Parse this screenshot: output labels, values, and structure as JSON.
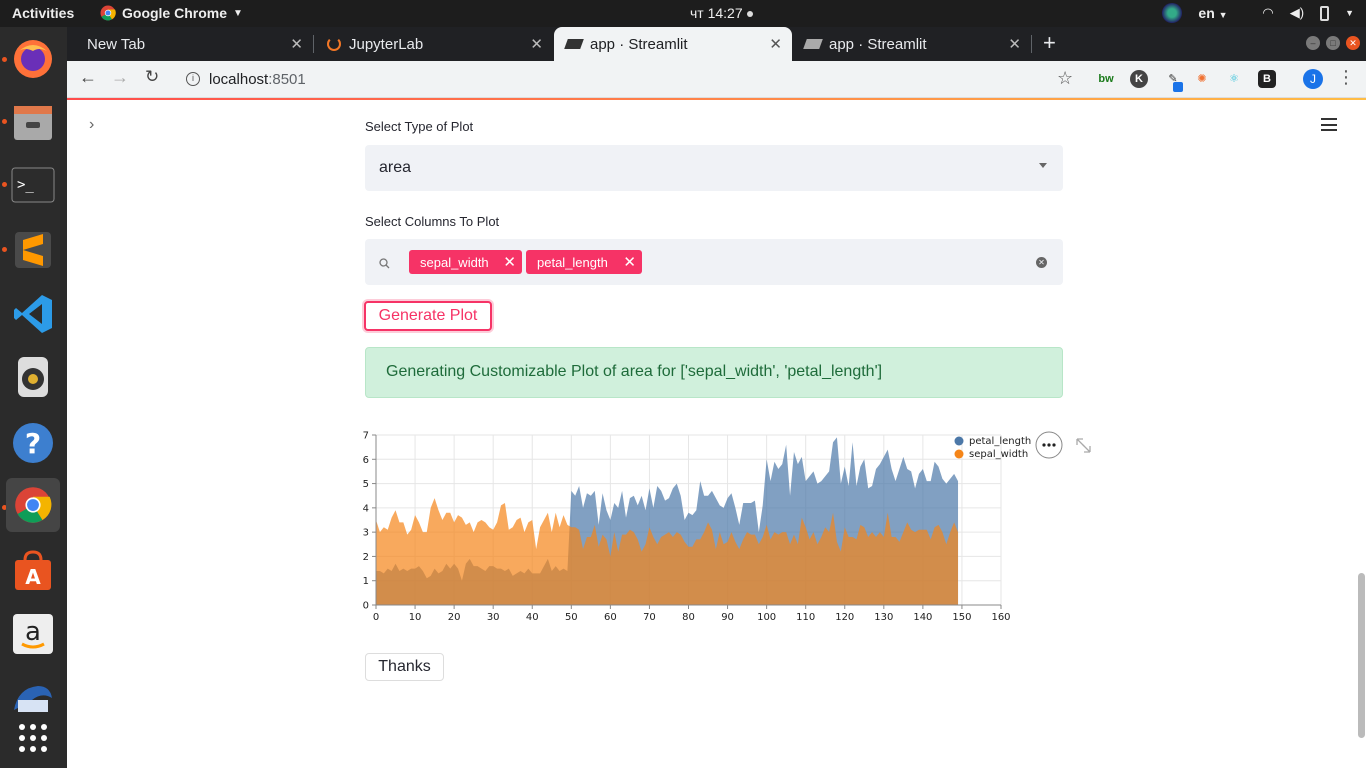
{
  "topbar": {
    "activities": "Activities",
    "app_name": "Google Chrome",
    "clock": "чт 14:27",
    "language": "en"
  },
  "dock": {
    "items": [
      "firefox-icon",
      "files-icon",
      "terminal-icon",
      "sublime-text-icon",
      "vscode-icon",
      "rhythmbox-icon",
      "help-icon",
      "chrome-icon",
      "software-center-icon",
      "amazon-icon",
      "thunderbird-icon",
      "show-apps-icon"
    ]
  },
  "browser": {
    "tabs": [
      {
        "title": "New Tab"
      },
      {
        "title": "JupyterLab"
      },
      {
        "title": "app · Streamlit"
      },
      {
        "title": "app · Streamlit"
      }
    ],
    "url_host": "localhost",
    "url_port": ":8501",
    "profile_initial": "J",
    "extensions": [
      "bw",
      "K",
      "B"
    ]
  },
  "app": {
    "plot_type_label": "Select Type of Plot",
    "plot_type_value": "area",
    "columns_label": "Select Columns To Plot",
    "selected_columns": [
      "sepal_width",
      "petal_length"
    ],
    "generate_button": "Generate Plot",
    "success_message": "Generating Customizable Plot of area for ['sepal_width', 'petal_length']",
    "thanks_button": "Thanks"
  },
  "colors": {
    "primary": "#f63366",
    "petal_length": "#4c78a8",
    "sepal_width": "#f58518",
    "success_bg": "#d0f0dc",
    "success_text": "#1e6b3a"
  },
  "chart_data": {
    "type": "area",
    "stacked": false,
    "x": "index 0–149",
    "xlim": [
      0,
      160
    ],
    "ylim": [
      0,
      7
    ],
    "xticks": [
      0,
      10,
      20,
      30,
      40,
      50,
      60,
      70,
      80,
      90,
      100,
      110,
      120,
      130,
      140,
      150,
      160
    ],
    "yticks": [
      0,
      1,
      2,
      3,
      4,
      5,
      6,
      7
    ],
    "grid": true,
    "legend_position": "top-right",
    "series": [
      {
        "name": "petal_length",
        "color": "#4c78a8",
        "values": [
          1.4,
          1.4,
          1.3,
          1.5,
          1.4,
          1.7,
          1.4,
          1.5,
          1.4,
          1.5,
          1.5,
          1.6,
          1.4,
          1.1,
          1.2,
          1.5,
          1.3,
          1.4,
          1.7,
          1.5,
          1.7,
          1.5,
          1.0,
          1.7,
          1.9,
          1.6,
          1.6,
          1.5,
          1.4,
          1.6,
          1.6,
          1.5,
          1.5,
          1.4,
          1.5,
          1.2,
          1.3,
          1.4,
          1.3,
          1.5,
          1.3,
          1.3,
          1.3,
          1.6,
          1.9,
          1.4,
          1.6,
          1.4,
          1.5,
          1.4,
          4.7,
          4.5,
          4.9,
          4.0,
          4.6,
          4.5,
          4.7,
          3.3,
          4.6,
          3.9,
          3.5,
          4.2,
          4.0,
          4.7,
          3.6,
          4.4,
          4.5,
          4.1,
          4.5,
          3.9,
          4.8,
          4.0,
          4.9,
          4.7,
          4.3,
          4.4,
          4.8,
          5.0,
          4.5,
          3.5,
          3.8,
          3.7,
          3.9,
          5.1,
          4.5,
          4.5,
          4.7,
          4.4,
          4.1,
          4.0,
          4.4,
          4.6,
          4.0,
          3.3,
          4.2,
          4.2,
          4.2,
          4.3,
          3.0,
          4.1,
          6.0,
          5.1,
          5.9,
          5.6,
          5.8,
          6.6,
          4.5,
          6.3,
          5.8,
          6.1,
          5.1,
          5.3,
          5.5,
          5.0,
          5.1,
          5.3,
          5.5,
          6.7,
          6.9,
          5.0,
          5.7,
          4.9,
          6.7,
          4.9,
          5.7,
          6.0,
          4.8,
          4.9,
          5.6,
          5.8,
          6.1,
          6.4,
          5.6,
          5.1,
          5.6,
          6.1,
          5.6,
          5.5,
          4.8,
          5.4,
          5.6,
          5.1,
          5.1,
          5.9,
          5.7,
          5.2,
          5.0,
          5.2,
          5.4,
          5.1
        ]
      },
      {
        "name": "sepal_width",
        "color": "#f58518",
        "values": [
          3.5,
          3.0,
          3.2,
          3.1,
          3.6,
          3.9,
          3.4,
          3.4,
          2.9,
          3.1,
          3.7,
          3.4,
          3.0,
          3.0,
          4.0,
          4.4,
          3.9,
          3.5,
          3.8,
          3.8,
          3.4,
          3.7,
          3.6,
          3.3,
          3.4,
          3.0,
          3.4,
          3.5,
          3.4,
          3.2,
          3.1,
          3.4,
          4.1,
          4.2,
          3.1,
          3.2,
          3.5,
          3.6,
          3.0,
          3.4,
          3.5,
          2.3,
          3.2,
          3.5,
          3.8,
          3.0,
          3.8,
          3.2,
          3.7,
          3.3,
          3.2,
          3.2,
          3.1,
          2.3,
          2.8,
          2.8,
          3.3,
          2.4,
          2.9,
          2.7,
          2.0,
          3.0,
          2.2,
          2.9,
          2.9,
          3.1,
          3.0,
          2.7,
          2.2,
          2.5,
          3.2,
          2.8,
          2.5,
          2.8,
          2.9,
          3.0,
          2.8,
          3.0,
          2.9,
          2.6,
          2.4,
          2.4,
          2.7,
          2.7,
          3.0,
          3.4,
          3.1,
          2.3,
          3.0,
          2.5,
          2.6,
          3.0,
          2.6,
          2.3,
          2.7,
          3.0,
          2.9,
          2.9,
          2.5,
          2.8,
          3.3,
          2.7,
          3.0,
          2.9,
          3.0,
          3.0,
          2.5,
          2.9,
          2.5,
          3.6,
          3.2,
          2.7,
          3.0,
          2.5,
          2.8,
          3.2,
          3.0,
          3.8,
          2.6,
          2.2,
          3.2,
          2.8,
          2.8,
          2.7,
          3.3,
          3.2,
          2.8,
          3.0,
          2.8,
          3.0,
          2.8,
          3.8,
          2.8,
          2.8,
          2.6,
          3.0,
          3.4,
          3.1,
          3.0,
          3.1,
          3.1,
          3.1,
          2.7,
          3.2,
          3.3,
          3.0,
          2.5,
          3.0,
          3.4,
          3.0
        ]
      }
    ]
  }
}
